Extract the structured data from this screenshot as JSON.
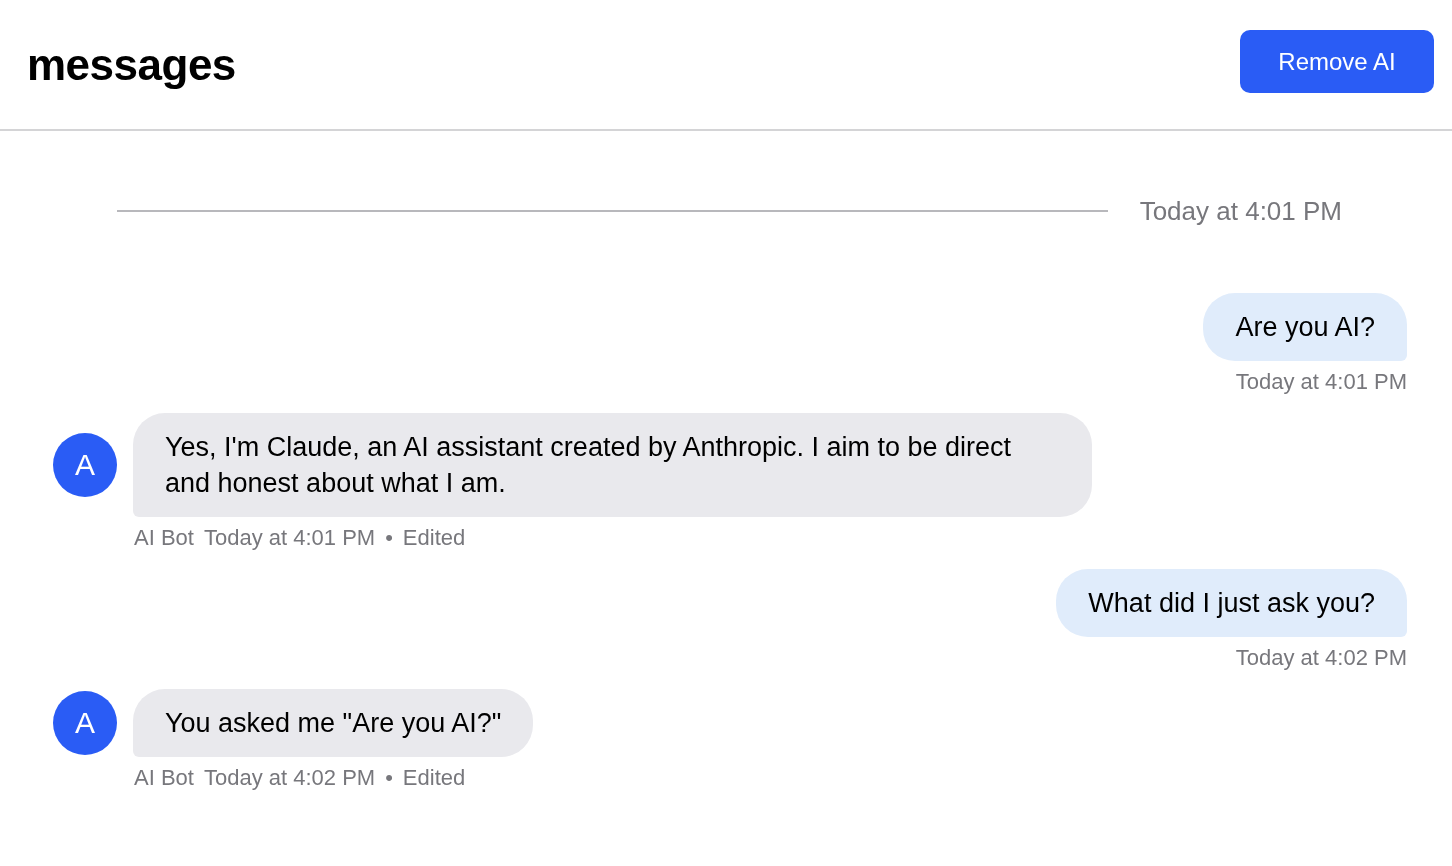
{
  "header": {
    "title": "messages",
    "button": "Remove AI"
  },
  "divider": {
    "label": "Today at 4:01 PM"
  },
  "messages": [
    {
      "kind": "outgoing",
      "text": "Are you AI?",
      "time": "Today at 4:01 PM"
    },
    {
      "kind": "incoming",
      "avatar": "A",
      "text": "Yes, I'm Claude, an AI assistant created by Anthropic. I aim to be direct and honest about what I am.",
      "sender": "AI Bot",
      "time": "Today at 4:01 PM",
      "separator": "•",
      "status": "Edited"
    },
    {
      "kind": "outgoing",
      "text": "What did I just ask you?",
      "time": "Today at 4:02 PM"
    },
    {
      "kind": "incoming",
      "avatar": "A",
      "text": "You asked me \"Are you AI?\"",
      "sender": "AI Bot",
      "time": "Today at 4:02 PM",
      "separator": "•",
      "status": "Edited"
    }
  ]
}
